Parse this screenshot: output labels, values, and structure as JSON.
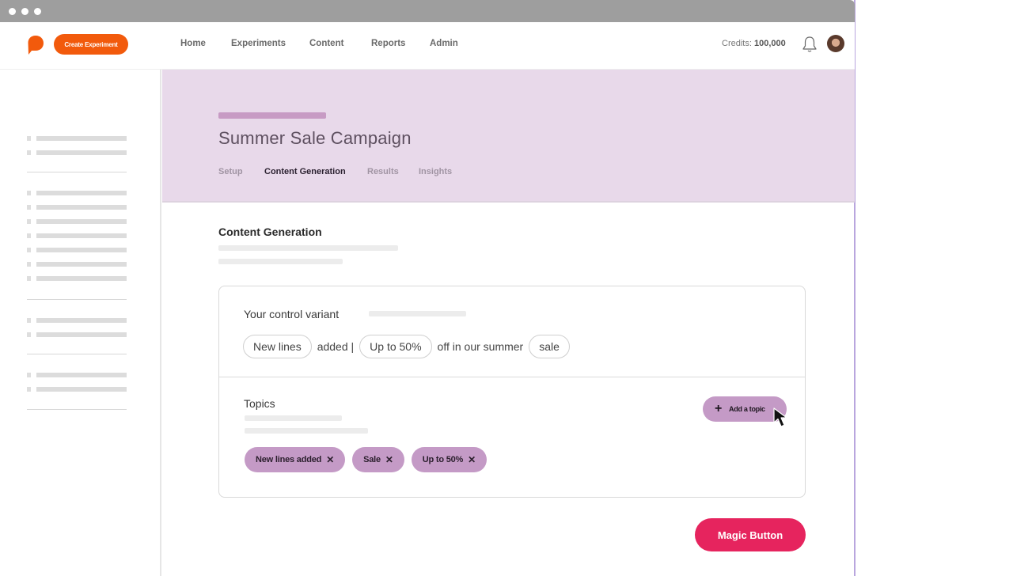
{
  "window": {
    "controls": [
      "dot-1",
      "dot-2",
      "dot-3"
    ]
  },
  "topnav": {
    "logo_icon": "brand-logo-icon",
    "create_button": "Create Experiment",
    "links": [
      "Home",
      "Experiments",
      "Content",
      "Reports",
      "Admin"
    ],
    "credits_label": "Credits:",
    "credits_value": "100,000",
    "bell_icon": "bell-icon",
    "avatar_icon": "user-avatar"
  },
  "header": {
    "title": "Summer Sale Campaign",
    "tabs": [
      {
        "label": "Setup",
        "active": false
      },
      {
        "label": "Content Generation",
        "active": true
      },
      {
        "label": "Results",
        "active": false
      },
      {
        "label": "Insights",
        "active": false
      }
    ]
  },
  "content": {
    "section_title": "Content Generation",
    "control_variant": {
      "label": "Your control variant",
      "segments": [
        {
          "type": "pill",
          "text": "New lines"
        },
        {
          "type": "text",
          "text": "added |"
        },
        {
          "type": "pill",
          "text": "Up to 50%"
        },
        {
          "type": "text",
          "text": "off in our summer"
        },
        {
          "type": "pill",
          "text": "sale"
        }
      ]
    },
    "topics": {
      "label": "Topics",
      "add_button": "Add a topic",
      "chips": [
        "New lines added",
        "Sale",
        "Up to 50%"
      ],
      "remove_glyph": "✕"
    },
    "magic_button": "Magic Button"
  },
  "colors": {
    "brand_orange": "#f25a0c",
    "header_bg": "#e8d9ea",
    "chip_purple": "#c49ac6",
    "magic_pink": "#e6245e"
  }
}
